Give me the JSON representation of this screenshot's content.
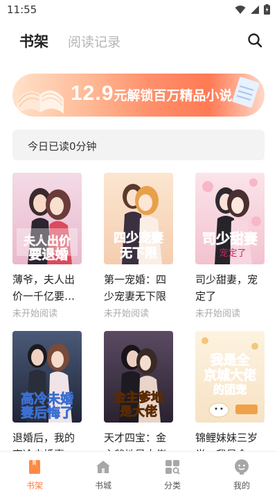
{
  "status_bar": {
    "time": "11:55"
  },
  "header": {
    "tab_shelf": "书架",
    "tab_history": "阅读记录"
  },
  "banner": {
    "price": "12.9",
    "text": "元解锁百万精品小说"
  },
  "reading": {
    "text": "今日已读0分钟"
  },
  "books": [
    {
      "title": "薄爷，夫人出价一千亿要退婚",
      "status": "未开始阅读"
    },
    {
      "title": "第一宠婚：四少宠妻无下限",
      "status": "未开始阅读"
    },
    {
      "title": "司少甜妻，宠定了",
      "status": "未开始阅读"
    },
    {
      "title": "退婚后，我的高冷未婚妻后悔了",
      "status": ""
    },
    {
      "title": "天才四宝：金主爹地是大佬",
      "status": ""
    },
    {
      "title": "锦鲤妹妹三岁半，我是全京城大佬的团宠",
      "status": ""
    }
  ],
  "nav": [
    {
      "label": "书架",
      "icon": "bookshelf-icon",
      "active": true
    },
    {
      "label": "书城",
      "icon": "store-icon",
      "active": false
    },
    {
      "label": "分类",
      "icon": "category-icon",
      "active": false
    },
    {
      "label": "我的",
      "icon": "profile-icon",
      "active": false
    }
  ],
  "colors": {
    "accent": "#ff7a3d",
    "banner": "#ff8f6a",
    "inactive_tab": "#b5b5b5",
    "muted": "#aaaaaa"
  }
}
